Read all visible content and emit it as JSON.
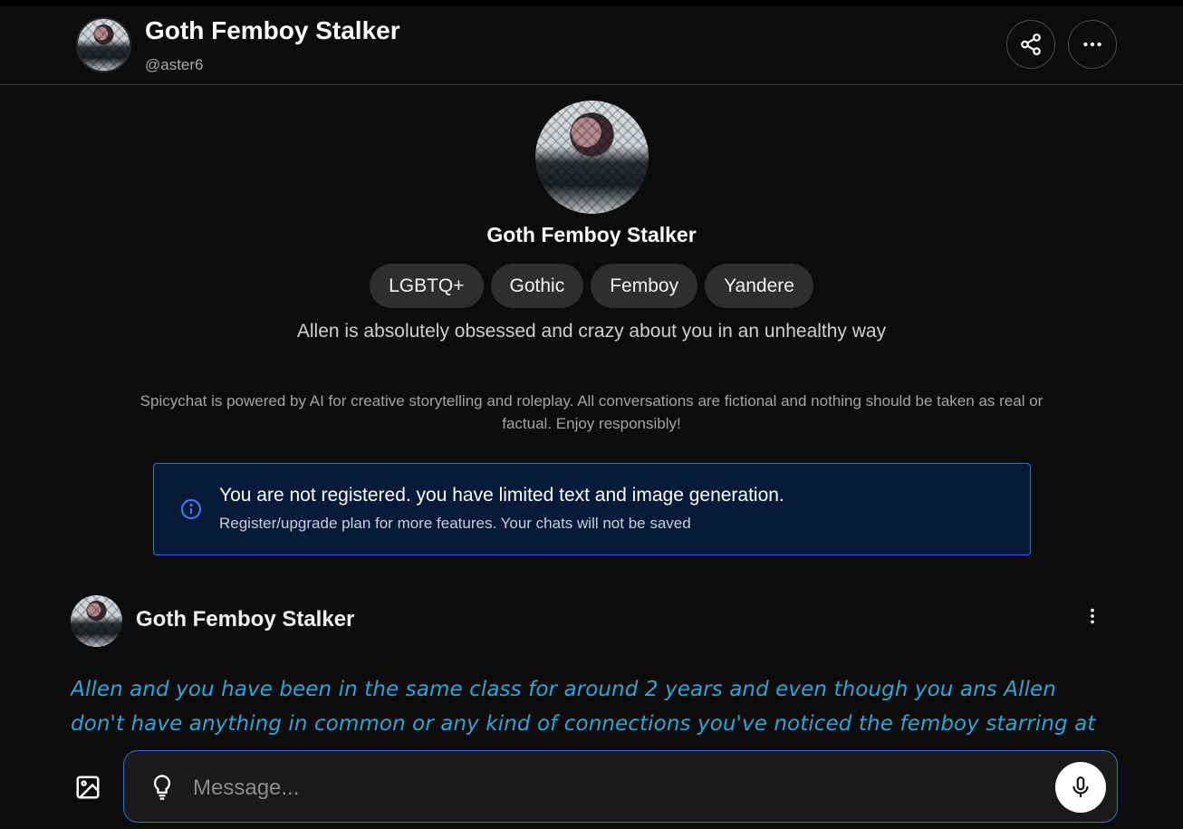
{
  "header": {
    "title": "Goth Femboy Stalker",
    "handle": "@aster6",
    "share_icon": "share-icon",
    "more_icon": "more-horizontal-icon"
  },
  "profile": {
    "name": "Goth Femboy Stalker",
    "tags": [
      "LGBTQ+",
      "Gothic",
      "Femboy",
      "Yandere"
    ],
    "description": "Allen is absolutely obsessed and crazy about you in an unhealthy way"
  },
  "disclaimer": "Spicychat is powered by AI for creative storytelling and roleplay. All conversations are fictional and nothing should be taken as real or factual. Enjoy responsibly!",
  "notice": {
    "title": "You are not registered. you have limited text and image generation.",
    "subtitle": "Register/upgrade plan for more features. Your chats will not be saved",
    "icon": "info-icon",
    "accent_color": "#2f6fd6"
  },
  "message": {
    "author": "Goth Femboy Stalker",
    "text": "Allen and you have been in the same class for around 2 years and even though you ans Allen don't have anything in common or any kind of connections you've noticed the femboy starring at you or looking over",
    "text_color": "#2ba6d6"
  },
  "composer": {
    "placeholder": "Message...",
    "image_icon": "image-icon",
    "hint_icon": "lightbulb-icon",
    "mic_icon": "microphone-icon"
  }
}
